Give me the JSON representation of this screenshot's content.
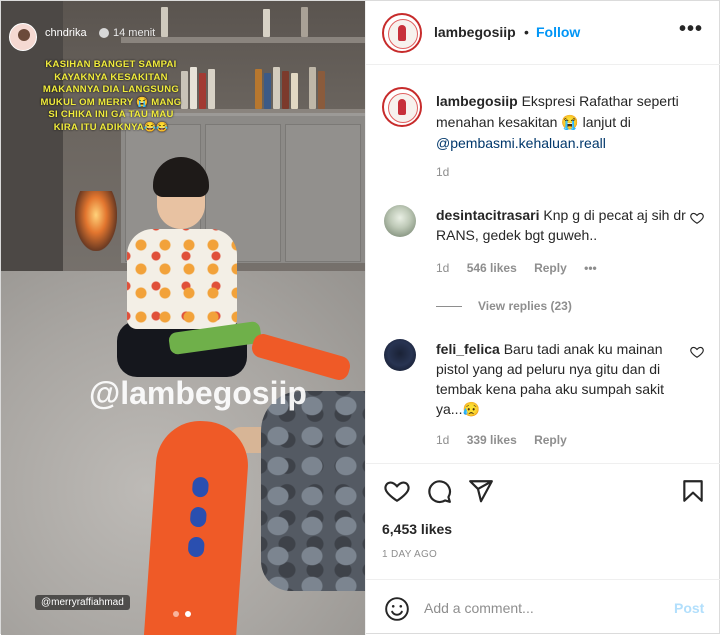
{
  "media": {
    "story_user": "chndrika",
    "story_time": "14 menit",
    "overlay_lines": [
      "KASIHAN BANGET SAMPAI",
      "KAYAKNYA KESAKITAN",
      "MAKANNYA DIA LANGSUNG",
      "MUKUL OM MERRY 😭 MANG",
      "SI CHIKA INI GA TAU MAU",
      "KIRA ITU ADIKNYA😂😂"
    ],
    "watermark": "@lambegosiip",
    "credit_tag": "@merryraffiahmad",
    "slide_count": 2,
    "active_slide": 2
  },
  "header": {
    "username": "lambegosiip",
    "separator": "•",
    "follow_label": "Follow",
    "more_label": "•••"
  },
  "caption": {
    "username": "lambegosiip",
    "text": " Ekspresi Rafathar seperti menahan kesakitan 😭 lanjut di ",
    "mention": "@pembasmi.kehaluan.reall",
    "time": "1d"
  },
  "comments": [
    {
      "username": "desintacitrasari",
      "text": " Knp g di pecat aj sih dr RANS, gedek bgt guweh..",
      "time": "1d",
      "likes": "546 likes",
      "reply_label": "Reply",
      "more_label": "•••",
      "view_replies": "View replies (23)"
    },
    {
      "username": "feli_felica",
      "text": " Baru tadi anak ku mainan pistol yang ad peluru nya gitu dan di tembak kena paha aku sumpah sakit ya...😥",
      "time": "1d",
      "likes": "339 likes",
      "reply_label": "Reply"
    }
  ],
  "stats": {
    "likes": "6,453 likes",
    "date": "1 DAY AGO"
  },
  "add_comment": {
    "placeholder": "Add a comment...",
    "post_label": "Post"
  },
  "colors": {
    "accent": "#0095f6",
    "post_disabled": "#b2dffc",
    "overlay_text": "#f1ec3c"
  }
}
